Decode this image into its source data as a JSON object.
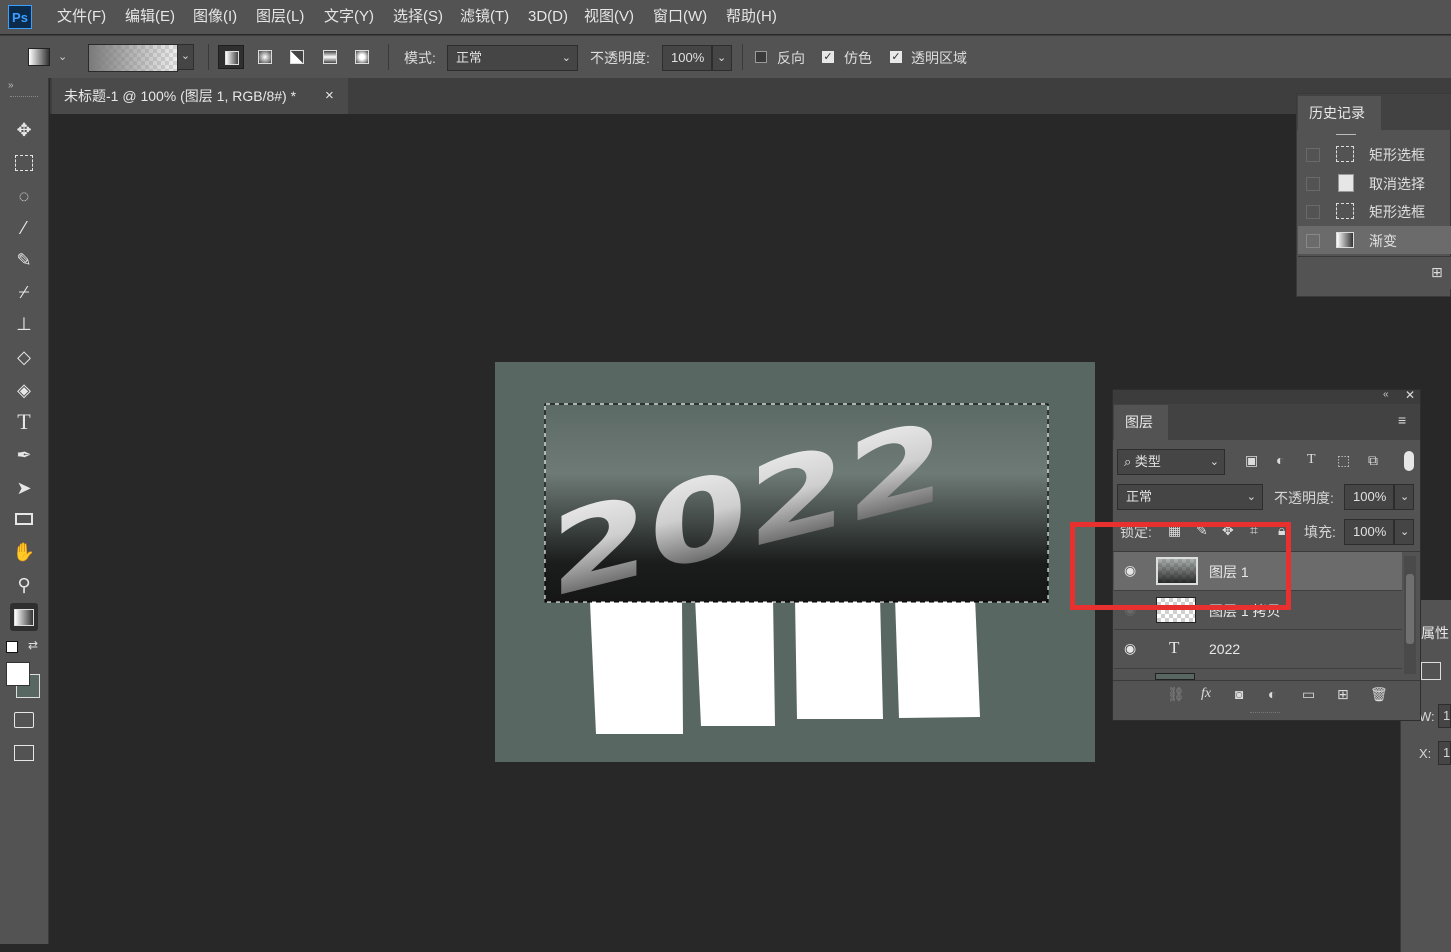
{
  "app": {
    "logo": "Ps"
  },
  "menu": [
    "文件(F)",
    "编辑(E)",
    "图像(I)",
    "图层(L)",
    "文字(Y)",
    "选择(S)",
    "滤镜(T)",
    "3D(D)",
    "视图(V)",
    "窗口(W)",
    "帮助(H)"
  ],
  "options": {
    "mode_label": "模式:",
    "mode_value": "正常",
    "opacity_label": "不透明度:",
    "opacity_value": "100%",
    "reverse_label": "反向",
    "reverse_checked": false,
    "dither_label": "仿色",
    "dither_checked": true,
    "transparency_label": "透明区域",
    "transparency_checked": true
  },
  "document": {
    "tab_title": "未标题-1 @ 100% (图层 1, RGB/8#) *",
    "close": "×"
  },
  "canvas": {
    "text": "2022",
    "bg_color": "#596762"
  },
  "history": {
    "tab": "历史记录",
    "items": [
      {
        "label": "矩形选框",
        "icon": "marquee-icon"
      },
      {
        "label": "取消选择",
        "icon": "document-icon"
      },
      {
        "label": "矩形选框",
        "icon": "marquee-icon"
      },
      {
        "label": "渐变",
        "icon": "gradient-icon"
      }
    ]
  },
  "layers": {
    "tab": "图层",
    "filter_label": "类型",
    "blend_mode": "正常",
    "opacity_label": "不透明度:",
    "opacity_value": "100%",
    "lock_label": "锁定:",
    "fill_label": "填充:",
    "fill_value": "100%",
    "items": [
      {
        "name": "图层 1",
        "visible": true,
        "selected": true
      },
      {
        "name": "图层 1 拷贝",
        "visible": false,
        "selected": false
      },
      {
        "name": "2022",
        "visible": true,
        "selected": false,
        "type": "text"
      }
    ]
  },
  "properties": {
    "tab": "属性",
    "w_label": "W:",
    "w_value": "1",
    "x_label": "X:",
    "x_value": "1"
  },
  "highlight_color": "#e8312f"
}
